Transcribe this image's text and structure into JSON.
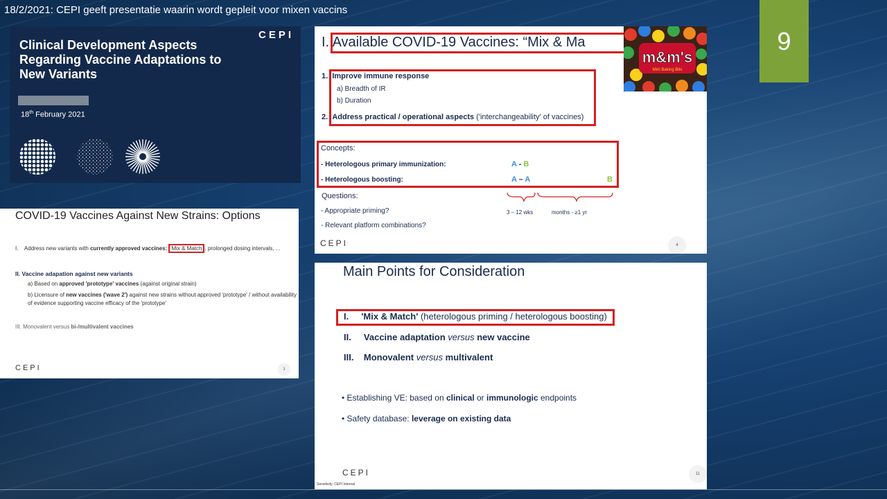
{
  "header": {
    "title": "18/2/2021: CEPI geeft presentatie waarin wordt gepleit voor mixen vaccins",
    "page_number": "9"
  },
  "slide1": {
    "title": "Clinical Development Aspects Regarding Vaccine Adaptations to New Variants",
    "logo": "CEPI",
    "date_day": "18",
    "date_suffix": "th",
    "date_rest": " February 2021"
  },
  "slide2": {
    "title": "COVID-19 Vaccines Against New Strains: Options",
    "item1_num": "I.",
    "item1_pre": "Address new variants with ",
    "item1_bold": "currently approved vaccines:",
    "item1_box": "Mix & Match",
    "item1_post": ", prolonged dosing intervals, ...",
    "item2": "II.  Vaccine adapation against new variants",
    "item2a_pre": "a)  Based on ",
    "item2a_bold": "approved 'prototype' vaccines",
    "item2a_post": " (against original strain)",
    "item2b_pre": "b)  Licensure of ",
    "item2b_bold": "new vaccines ('wave 2')",
    "item2b_post": " against new strains without approved 'prototype' / without availability of evidence supporting vaccine efficacy of the 'prototype'",
    "item3_pre": "III.  Monovalent versus ",
    "item3_bold": "bi-/multivalent vaccines",
    "logo": "CEPI",
    "page": "3"
  },
  "slide3": {
    "title": "I. Available COVID-19 Vaccines: “Mix & Ma",
    "candy_label": "Mini Baking Bits",
    "item1_num": "1.",
    "item1": "Improve immune response",
    "item1a": "a)   Breadth of IR",
    "item1b": "b)   Duration",
    "item2_num": "2.",
    "item2_bold": "Address practical / operational aspects",
    "item2_post": " ('interchangeability' of vaccines)",
    "concepts": "Concepts:",
    "c1": "-    Heterologous primary immunization:",
    "c1_a": "A",
    "c1_dash": " - ",
    "c1_b": "B",
    "c2": "-    Heterologous boosting:",
    "c2_a1": "A",
    "c2_dash": " – ",
    "c2_a2": "A",
    "c2_b": "B",
    "questions": "Questions:",
    "q1": "-    Appropriate priming?",
    "q2": "-    Relevant platform combinations?",
    "interval1": "3 – 12 wks",
    "interval2": "months - ≥1 yr",
    "logo": "CEPI",
    "page": "4"
  },
  "slide4": {
    "title": "Main Points for Consideration",
    "p1_num": "I.",
    "p1_bold": "'Mix & Match'",
    "p1_post": " (heterologous priming / heterologous boosting)",
    "p2_num": "II.",
    "p2_pre": "Vaccine adaptation ",
    "p2_it": "versus",
    "p2_post": " new vaccine",
    "p3_num": "III.",
    "p3_pre": "Monovalent ",
    "p3_it": "versus",
    "p3_post": " multivalent",
    "b1_pre": "•  Establishing VE: based on ",
    "b1_b1": "clinical",
    "b1_mid": " or ",
    "b1_b2": "immunologic",
    "b1_post": " endpoints",
    "b2_pre": "•  Safety database: ",
    "b2_bold": "leverage on existing data",
    "logo": "CEPI",
    "sensitivity": "Sensitivity: CEPI Internal",
    "page": "11"
  },
  "colors": {
    "accent_green": "#7da23a",
    "highlight_red": "#d32020",
    "cepi_navy": "#13294b",
    "concept_blue": "#3a8fd6",
    "concept_green": "#8cc63f"
  }
}
